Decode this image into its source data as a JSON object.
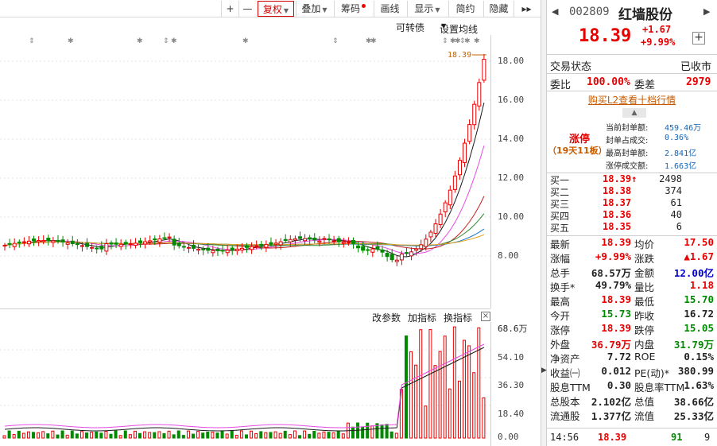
{
  "toolbar": {
    "plus": "+",
    "minus": "—",
    "fuquan": "复权",
    "diejia": "叠加",
    "chouma": "筹码",
    "huaxian": "画线",
    "xianshi": "显示",
    "jianyue": "简约",
    "yincang": "隐藏",
    "more": "▸▸"
  },
  "sub_toolbar": {
    "kezhuanzhai": "可转债",
    "junxian": "设置均线"
  },
  "price_axis": [
    "18.00",
    "16.00",
    "14.00",
    "12.00",
    "10.00",
    "8.00"
  ],
  "price_marker": "18.39",
  "vol_toolbar": {
    "gaican": "改参数",
    "jiazhibiao": "加指标",
    "huanzhibiao": "换指标",
    "close": "×"
  },
  "vol_axis": [
    "68.6万",
    "54.10",
    "36.30",
    "18.40",
    "0.00"
  ],
  "stock": {
    "code": "002809",
    "name": "红墙股份",
    "price": "18.39",
    "change": "+1.67",
    "pct": "+9.99%",
    "prev_arrow": "◀",
    "next_arrow": "▶",
    "plus": "+"
  },
  "status": {
    "label": "交易状态",
    "value": "已收市"
  },
  "weibi": {
    "label": "委比",
    "value": "100.00%",
    "label2": "委差",
    "value2": "2979"
  },
  "l2_link": "购买L2查看十档行情",
  "limit_up": {
    "title": "涨停",
    "subtitle": "（19天11板）",
    "rows": [
      {
        "label": "当前封单额:",
        "value": "459.46万"
      },
      {
        "label": "封单占成交:",
        "value": "0.36%"
      },
      {
        "label": "最高封单额:",
        "value": "2.841亿"
      },
      {
        "label": "涨停成交额:",
        "value": "1.663亿"
      }
    ]
  },
  "bids": [
    {
      "label": "买一",
      "price": "18.39↑",
      "vol": "2498"
    },
    {
      "label": "买二",
      "price": "18.38",
      "vol": "374"
    },
    {
      "label": "买三",
      "price": "18.37",
      "vol": "61"
    },
    {
      "label": "买四",
      "price": "18.36",
      "vol": "40"
    },
    {
      "label": "买五",
      "price": "18.35",
      "vol": "6"
    }
  ],
  "quote": [
    {
      "l1": "最新",
      "v1": "18.39",
      "c1": "red",
      "l2": "均价",
      "v2": "17.50",
      "c2": "red"
    },
    {
      "l1": "涨幅",
      "v1": "+9.99%",
      "c1": "red",
      "l2": "涨跌",
      "v2": "▲1.67",
      "c2": "red"
    },
    {
      "l1": "总手",
      "v1": "68.57万",
      "c1": "",
      "l2": "金额",
      "v2": "12.00亿",
      "c2": "blue"
    },
    {
      "l1": "换手*",
      "v1": "49.79%",
      "c1": "",
      "l2": "量比",
      "v2": "1.18",
      "c2": "red"
    },
    {
      "l1": "最高",
      "v1": "18.39",
      "c1": "red",
      "l2": "最低",
      "v2": "15.70",
      "c2": "green"
    },
    {
      "l1": "今开",
      "v1": "15.73",
      "c1": "green",
      "l2": "昨收",
      "v2": "16.72",
      "c2": ""
    },
    {
      "l1": "涨停",
      "v1": "18.39",
      "c1": "red",
      "l2": "跌停",
      "v2": "15.05",
      "c2": "green"
    },
    {
      "l1": "外盘",
      "v1": "36.79万",
      "c1": "red",
      "l2": "内盘",
      "v2": "31.79万",
      "c2": "green"
    },
    {
      "l1": "净资产",
      "v1": "7.72",
      "c1": "",
      "l2": "ROE",
      "v2": "0.15%",
      "c2": ""
    },
    {
      "l1": "收益㈠",
      "v1": "0.012",
      "c1": "",
      "l2": "PE(动)*",
      "v2": "380.99",
      "c2": ""
    },
    {
      "l1": "股息TTM",
      "v1": "0.30",
      "c1": "",
      "l2": "股息率TTM",
      "v2": "1.63%",
      "c2": ""
    },
    {
      "l1": "总股本",
      "v1": "2.102亿",
      "c1": "",
      "l2": "总值",
      "v2": "38.66亿",
      "c2": ""
    },
    {
      "l1": "流通股",
      "v1": "1.377亿",
      "c1": "",
      "l2": "流值",
      "v2": "25.33亿",
      "c2": ""
    }
  ],
  "tick": {
    "time": "14:56",
    "price": "18.39",
    "vol": "91",
    "n": "9"
  },
  "colors": {
    "up": "#e60000",
    "down": "#008a00",
    "ma5": "#1a1a1a",
    "ma10": "#e64ce6",
    "ma20": "#c41f1f",
    "ma30": "#2e8b2e",
    "ma60": "#1e78c8",
    "ma120": "#e3a21a"
  },
  "chart_data": {
    "type": "candlestick",
    "y_axis_price": [
      8.0,
      18.0
    ],
    "last_price": 18.39,
    "volume_axis_max": "68.6万"
  }
}
